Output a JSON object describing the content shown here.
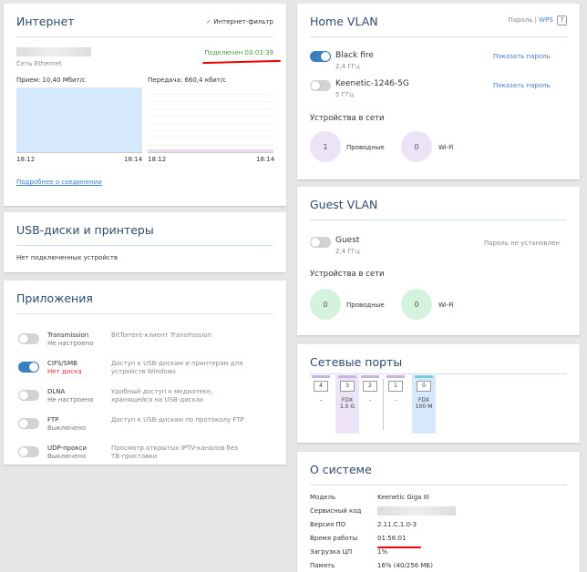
{
  "colors": {
    "accent": "#3a7fc2",
    "status_green": "#4a9a4a",
    "underline_red": "#e00000"
  },
  "internet": {
    "title": "Интернет",
    "filter_label": "Интернет-фильтр",
    "connection_type": "Сеть Ethernet",
    "status": "Подключен 03:03:39",
    "rx_label": "Прием: 10,40 Мбит/с",
    "tx_label": "Передача: 660,4 кбит/с",
    "rx_time_start": "18:12",
    "rx_time_end": "18:14",
    "tx_time_start": "18:12",
    "tx_time_end": "18:14",
    "details_link": "Подробнее о соединении"
  },
  "usb": {
    "title": "USB-диски и принтеры",
    "empty_text": "Нет подключенных устройств"
  },
  "apps": {
    "title": "Приложения",
    "items": [
      {
        "name": "Transmission",
        "status": "Не настроено",
        "desc": "BitTorrent-клиент Transmission",
        "on": false
      },
      {
        "name": "CIFS/SMB",
        "status": "Нет диска",
        "desc": "Доступ к USB-дискам и принтерам для устройств Windows",
        "on": true
      },
      {
        "name": "DLNA",
        "status": "Не настроено",
        "desc": "Удобный доступ к медиатеке, хранящейся на USB-дисках",
        "on": false
      },
      {
        "name": "FTP",
        "status": "Выключено",
        "desc": "Доступ к USB-дискам по протоколу FTP",
        "on": false
      },
      {
        "name": "UDP-прокси",
        "status": "Выключено",
        "desc": "Просмотр открытых IPTV-каналов без TB-приставки",
        "on": false
      }
    ]
  },
  "home_vlan": {
    "title": "Home VLAN",
    "password_link": "Пароль",
    "separator": "|",
    "wps_link": "WPS",
    "networks": [
      {
        "ssid": "Black fire",
        "band": "2,4 ГГц",
        "show_password": "Показать пароль",
        "on": true
      },
      {
        "ssid": "Keenetic-1246-5G",
        "band": "5 ГГц",
        "show_password": "Показать пароль",
        "on": false
      }
    ],
    "devices_title": "Устройства в сети",
    "wired_count": "1",
    "wired_label": "Проводные",
    "wifi_count": "0",
    "wifi_label": "Wi-Fi"
  },
  "guest_vlan": {
    "title": "Guest VLAN",
    "ssid": "Guest",
    "band": "2,4 ГГц",
    "password_status": "Пароль не установлен",
    "devices_title": "Устройства в сети",
    "wired_count": "0",
    "wired_label": "Проводные",
    "wifi_count": "0",
    "wifi_label": "Wi-Fi"
  },
  "ports": {
    "title": "Сетевые порты",
    "items": [
      {
        "num": "4",
        "state": "-"
      },
      {
        "num": "3",
        "state": "FDX",
        "speed": "1.0 G"
      },
      {
        "num": "2",
        "state": "-"
      },
      {
        "num": "1",
        "state": "-"
      },
      {
        "num": "0",
        "state": "FDX",
        "speed": "100 M"
      }
    ]
  },
  "system": {
    "title": "О системе",
    "rows": [
      {
        "label": "Модель",
        "value": "Keenetic Giga III"
      },
      {
        "label": "Сервисный код",
        "value": ""
      },
      {
        "label": "Версия ПО",
        "value": "2.11.C.1.0-3"
      },
      {
        "label": "Время работы",
        "value": "01:56:01"
      },
      {
        "label": "Загрузка ЦП",
        "value": "1%"
      },
      {
        "label": "Память",
        "value": "16% (40/256 МБ)"
      }
    ]
  }
}
